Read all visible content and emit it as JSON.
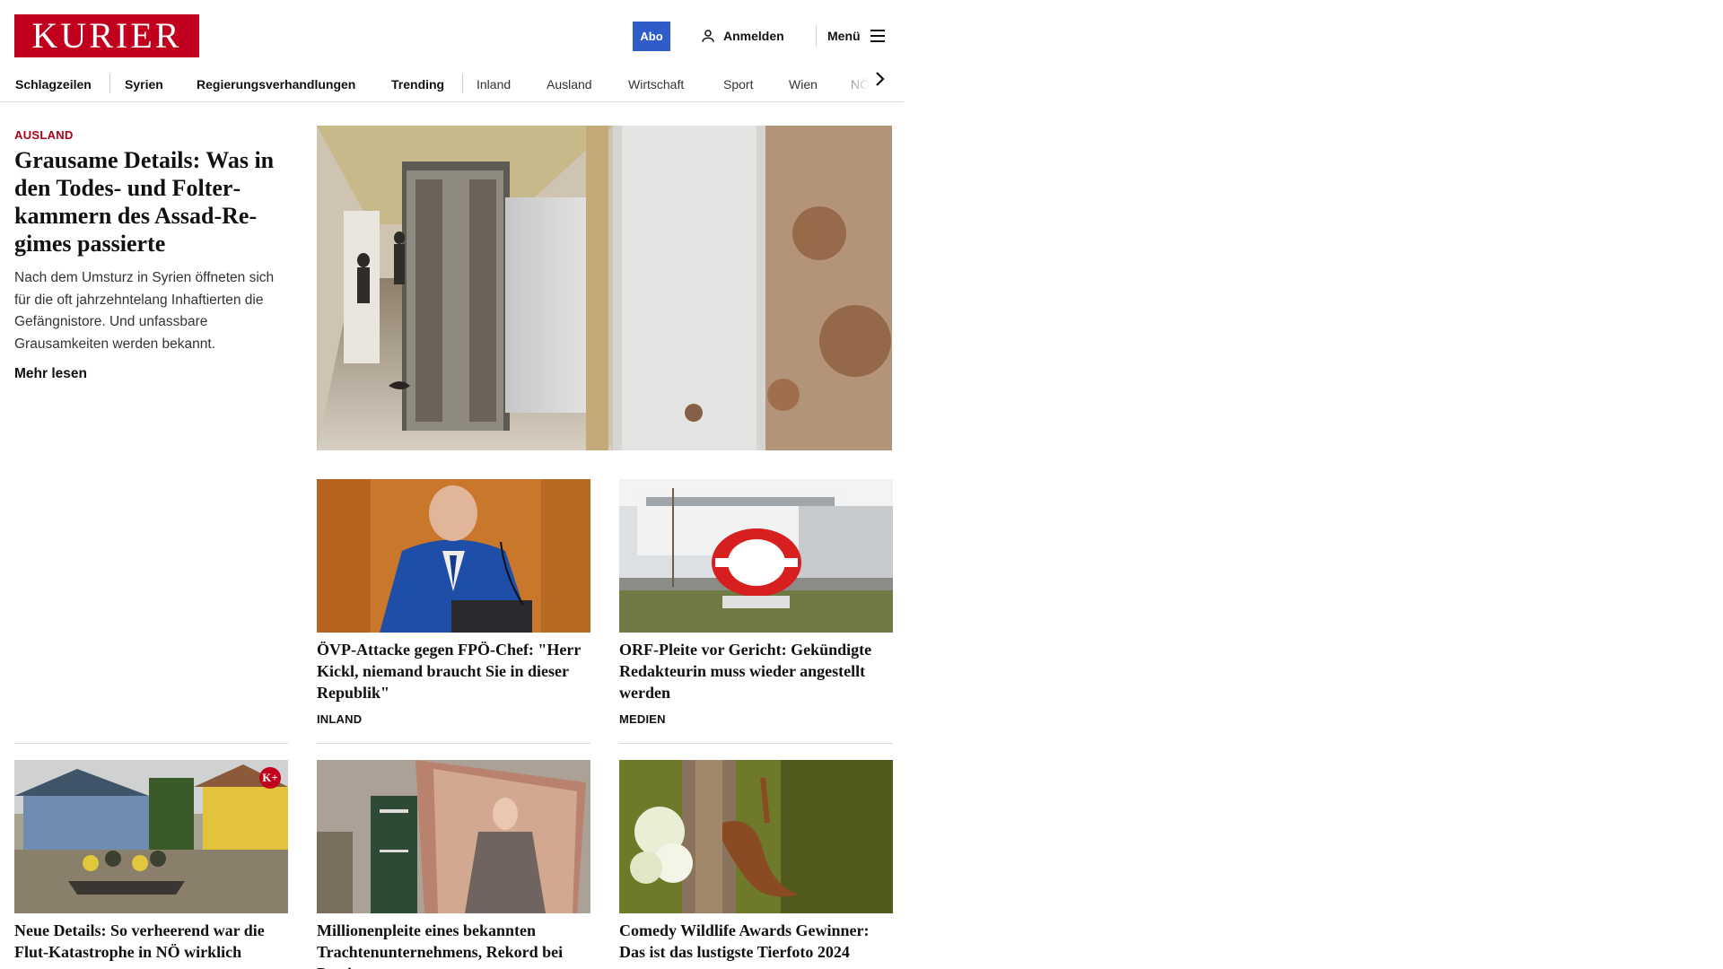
{
  "header": {
    "logo_text": "KURIER",
    "abo_label": "Abo",
    "login_label": "Anmelden",
    "menu_label": "Menü",
    "brand_color": "#c0001d",
    "abo_color": "#2e5dc9"
  },
  "nav": {
    "items": [
      "Schlagzeilen",
      "Syrien",
      "Regierungsverhandlungen",
      "Trending",
      "Inland",
      "Ausland",
      "Wirtschaft",
      "Sport",
      "Wien",
      "NÖ"
    ]
  },
  "lead": {
    "kicker": "AUSLAND",
    "title": "Grausame Details: Was in den Todes- und Folter­kammern des Assad-Re­gimes passierte",
    "teaser": "Nach dem Umsturz in Syrien öffneten sich für die oft jahrzehntelang Inhaftierten die Gefängnistore. Und unfassbare Grausamkeiten werden bekannt.",
    "more_label": "Mehr lesen"
  },
  "tiles": [
    {
      "title": "ÖVP-Attacke gegen FPÖ-Chef: \"Herr Kickl, niemand braucht Sie in dieser Republik\"",
      "category": "INLAND"
    },
    {
      "title": "ORF-Pleite vor Gericht: Gekündigte Redakteurin muss wieder ange­stellt werden",
      "category": "MEDIEN"
    },
    {
      "title": "Neue Details: So verheerend war die Flut-Katastrophe in NÖ wirklich",
      "badge": "K+"
    },
    {
      "title": "Millionenpleite eines bekannten Trachtenunternehmens, Rekord bei Passiva"
    },
    {
      "title": "Comedy Wildlife Awards Gewin­ner: Das ist das lustigste Tierfoto 2024"
    }
  ]
}
